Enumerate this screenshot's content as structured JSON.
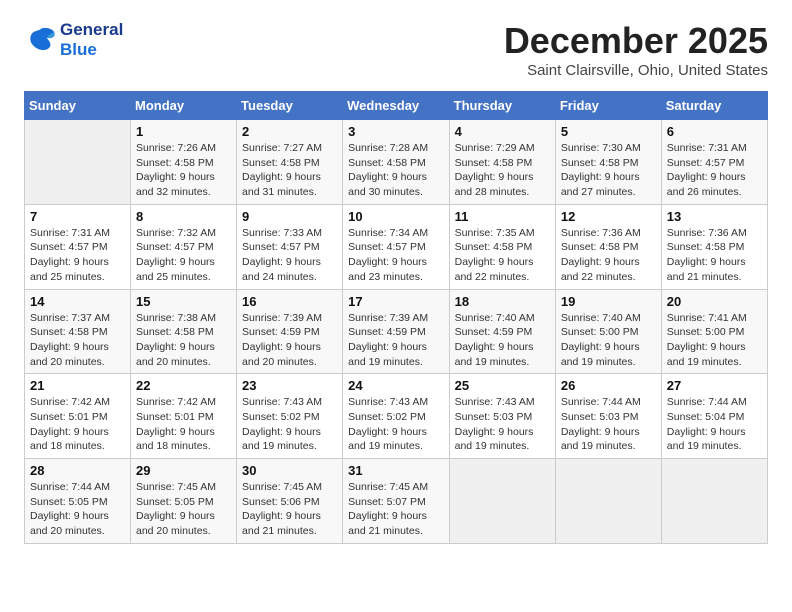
{
  "logo": {
    "line1": "General",
    "line2": "Blue"
  },
  "title": "December 2025",
  "location": "Saint Clairsville, Ohio, United States",
  "weekdays": [
    "Sunday",
    "Monday",
    "Tuesday",
    "Wednesday",
    "Thursday",
    "Friday",
    "Saturday"
  ],
  "weeks": [
    [
      {
        "day": "",
        "info": ""
      },
      {
        "day": "1",
        "info": "Sunrise: 7:26 AM\nSunset: 4:58 PM\nDaylight: 9 hours\nand 32 minutes."
      },
      {
        "day": "2",
        "info": "Sunrise: 7:27 AM\nSunset: 4:58 PM\nDaylight: 9 hours\nand 31 minutes."
      },
      {
        "day": "3",
        "info": "Sunrise: 7:28 AM\nSunset: 4:58 PM\nDaylight: 9 hours\nand 30 minutes."
      },
      {
        "day": "4",
        "info": "Sunrise: 7:29 AM\nSunset: 4:58 PM\nDaylight: 9 hours\nand 28 minutes."
      },
      {
        "day": "5",
        "info": "Sunrise: 7:30 AM\nSunset: 4:58 PM\nDaylight: 9 hours\nand 27 minutes."
      },
      {
        "day": "6",
        "info": "Sunrise: 7:31 AM\nSunset: 4:57 PM\nDaylight: 9 hours\nand 26 minutes."
      }
    ],
    [
      {
        "day": "7",
        "info": "Sunrise: 7:31 AM\nSunset: 4:57 PM\nDaylight: 9 hours\nand 25 minutes."
      },
      {
        "day": "8",
        "info": "Sunrise: 7:32 AM\nSunset: 4:57 PM\nDaylight: 9 hours\nand 25 minutes."
      },
      {
        "day": "9",
        "info": "Sunrise: 7:33 AM\nSunset: 4:57 PM\nDaylight: 9 hours\nand 24 minutes."
      },
      {
        "day": "10",
        "info": "Sunrise: 7:34 AM\nSunset: 4:57 PM\nDaylight: 9 hours\nand 23 minutes."
      },
      {
        "day": "11",
        "info": "Sunrise: 7:35 AM\nSunset: 4:58 PM\nDaylight: 9 hours\nand 22 minutes."
      },
      {
        "day": "12",
        "info": "Sunrise: 7:36 AM\nSunset: 4:58 PM\nDaylight: 9 hours\nand 22 minutes."
      },
      {
        "day": "13",
        "info": "Sunrise: 7:36 AM\nSunset: 4:58 PM\nDaylight: 9 hours\nand 21 minutes."
      }
    ],
    [
      {
        "day": "14",
        "info": "Sunrise: 7:37 AM\nSunset: 4:58 PM\nDaylight: 9 hours\nand 20 minutes."
      },
      {
        "day": "15",
        "info": "Sunrise: 7:38 AM\nSunset: 4:58 PM\nDaylight: 9 hours\nand 20 minutes."
      },
      {
        "day": "16",
        "info": "Sunrise: 7:39 AM\nSunset: 4:59 PM\nDaylight: 9 hours\nand 20 minutes."
      },
      {
        "day": "17",
        "info": "Sunrise: 7:39 AM\nSunset: 4:59 PM\nDaylight: 9 hours\nand 19 minutes."
      },
      {
        "day": "18",
        "info": "Sunrise: 7:40 AM\nSunset: 4:59 PM\nDaylight: 9 hours\nand 19 minutes."
      },
      {
        "day": "19",
        "info": "Sunrise: 7:40 AM\nSunset: 5:00 PM\nDaylight: 9 hours\nand 19 minutes."
      },
      {
        "day": "20",
        "info": "Sunrise: 7:41 AM\nSunset: 5:00 PM\nDaylight: 9 hours\nand 19 minutes."
      }
    ],
    [
      {
        "day": "21",
        "info": "Sunrise: 7:42 AM\nSunset: 5:01 PM\nDaylight: 9 hours\nand 18 minutes."
      },
      {
        "day": "22",
        "info": "Sunrise: 7:42 AM\nSunset: 5:01 PM\nDaylight: 9 hours\nand 18 minutes."
      },
      {
        "day": "23",
        "info": "Sunrise: 7:43 AM\nSunset: 5:02 PM\nDaylight: 9 hours\nand 19 minutes."
      },
      {
        "day": "24",
        "info": "Sunrise: 7:43 AM\nSunset: 5:02 PM\nDaylight: 9 hours\nand 19 minutes."
      },
      {
        "day": "25",
        "info": "Sunrise: 7:43 AM\nSunset: 5:03 PM\nDaylight: 9 hours\nand 19 minutes."
      },
      {
        "day": "26",
        "info": "Sunrise: 7:44 AM\nSunset: 5:03 PM\nDaylight: 9 hours\nand 19 minutes."
      },
      {
        "day": "27",
        "info": "Sunrise: 7:44 AM\nSunset: 5:04 PM\nDaylight: 9 hours\nand 19 minutes."
      }
    ],
    [
      {
        "day": "28",
        "info": "Sunrise: 7:44 AM\nSunset: 5:05 PM\nDaylight: 9 hours\nand 20 minutes."
      },
      {
        "day": "29",
        "info": "Sunrise: 7:45 AM\nSunset: 5:05 PM\nDaylight: 9 hours\nand 20 minutes."
      },
      {
        "day": "30",
        "info": "Sunrise: 7:45 AM\nSunset: 5:06 PM\nDaylight: 9 hours\nand 21 minutes."
      },
      {
        "day": "31",
        "info": "Sunrise: 7:45 AM\nSunset: 5:07 PM\nDaylight: 9 hours\nand 21 minutes."
      },
      {
        "day": "",
        "info": ""
      },
      {
        "day": "",
        "info": ""
      },
      {
        "day": "",
        "info": ""
      }
    ]
  ]
}
